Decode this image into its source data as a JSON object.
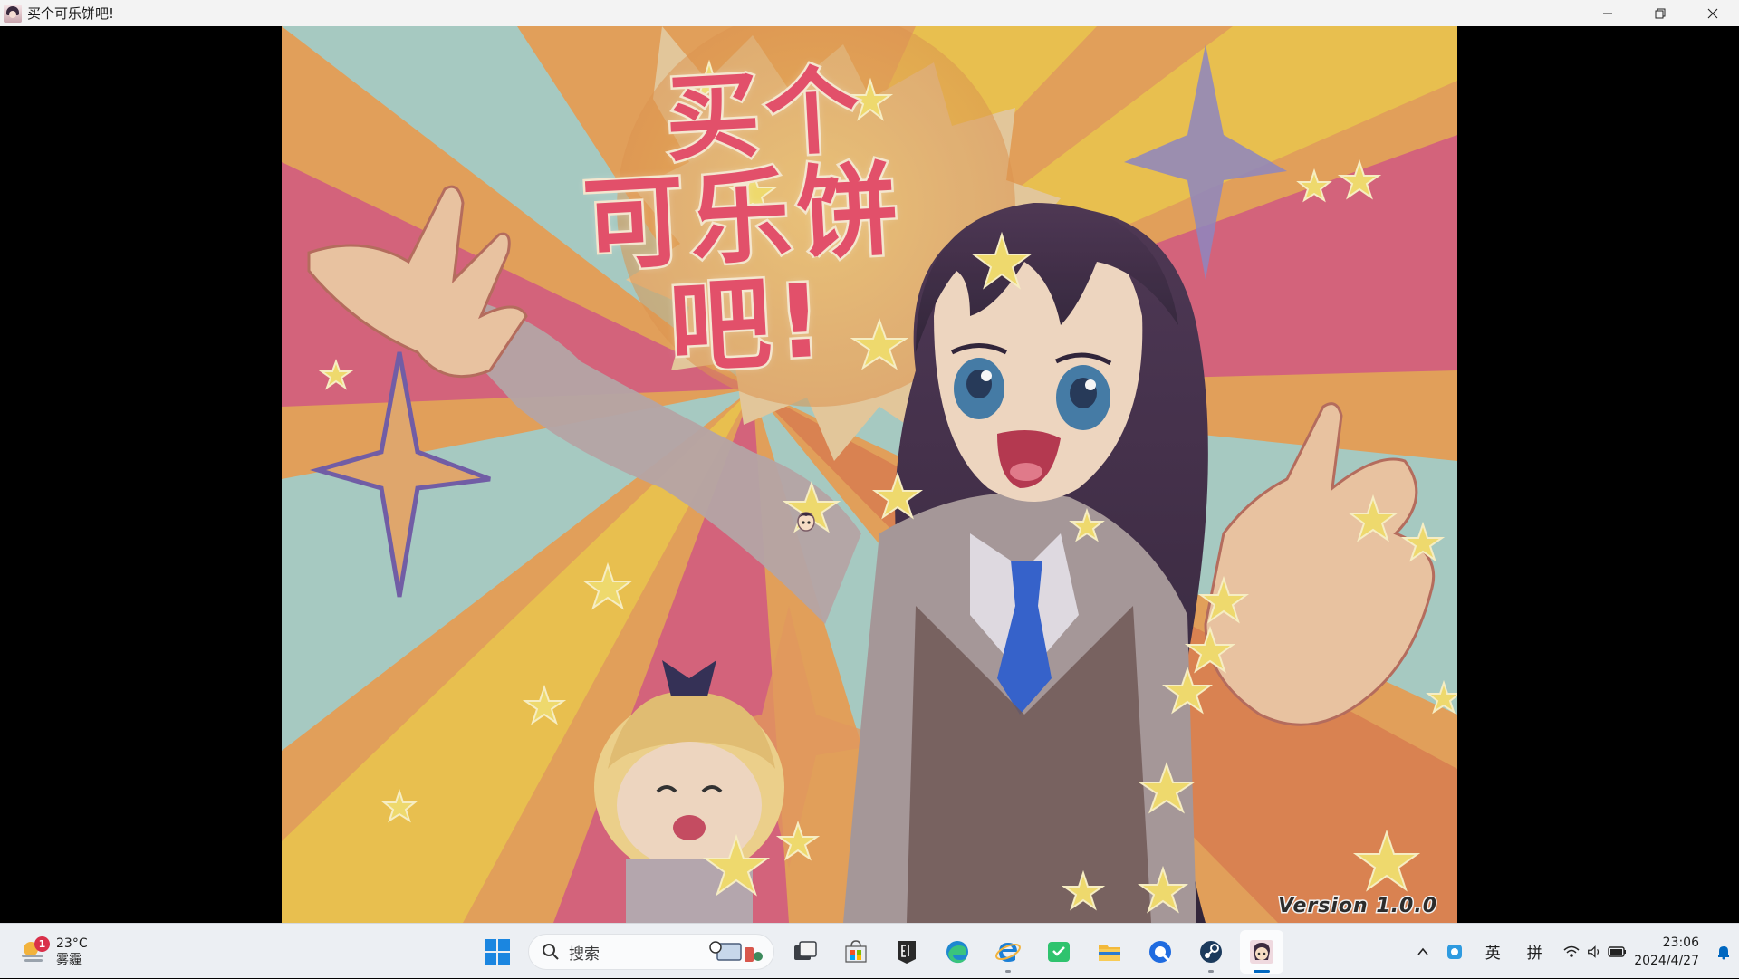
{
  "window": {
    "title": "买个可乐饼吧!",
    "controls": [
      "minimize-icon",
      "restore-icon",
      "close-icon"
    ]
  },
  "game": {
    "logo_line1": "买个",
    "logo_line2": "可乐饼吧!",
    "version": "Version 1.0.0",
    "colors": {
      "red": "#e2506a",
      "teal": "#a9cfc6",
      "yellow": "#f0c44a",
      "orange": "#e0824c",
      "pink": "#d9607a"
    }
  },
  "taskbar": {
    "weather": {
      "temp": "23°C",
      "condition": "雾霾",
      "badge": "1"
    },
    "search_placeholder": "搜索",
    "apps": [
      "start-icon",
      "search",
      "task-view-icon",
      "store-icon",
      "epic-games-icon",
      "edge-icon",
      "internet-explorer-icon",
      "chat-app-icon",
      "file-explorer-icon",
      "quark-browser-icon",
      "steam-icon",
      "game-app-icon"
    ],
    "tray": {
      "ime_lang": "英",
      "ime_mode": "拼"
    },
    "clock": {
      "time": "23:06",
      "date": "2024/4/27"
    }
  }
}
